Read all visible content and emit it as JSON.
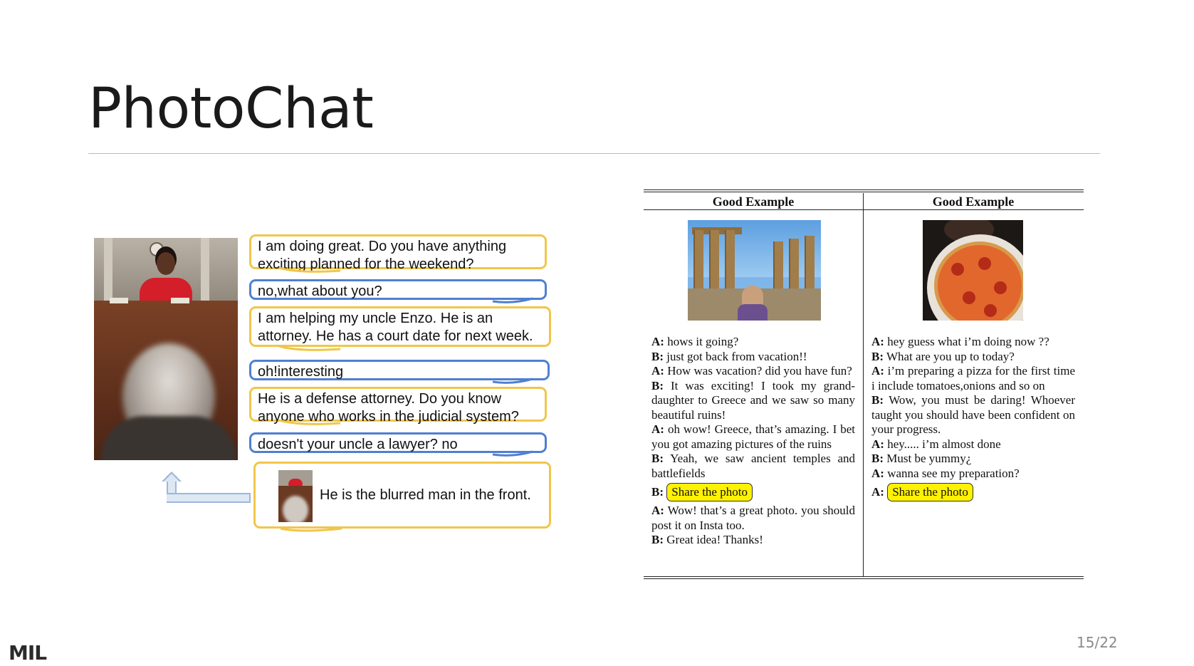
{
  "slide": {
    "title": "PhotoChat",
    "page_number": "15/22",
    "logo_text": "MIL"
  },
  "left_chat": {
    "bubbles": [
      {
        "text_line1": "I am doing great. Do you have anything",
        "text_line2": "exciting planned for the weekend?",
        "color": "#f0c64a"
      },
      {
        "text_line1": "no,what about you?",
        "color": "#4f7fd1"
      },
      {
        "text_line1": "I am helping my uncle Enzo. He is an",
        "text_line2": "attorney. He has a court date for next week.",
        "color": "#f0c64a"
      },
      {
        "text_line1": "oh!interesting",
        "color": "#4f7fd1"
      },
      {
        "text_line1": "He is a defense attorney. Do you know",
        "text_line2": "anyone who works in the judicial system?",
        "color": "#f0c64a"
      },
      {
        "text_line1": "doesn't your uncle a lawyer? no",
        "color": "#4f7fd1"
      },
      {
        "text_line1": "He is the blurred man in the front.",
        "color": "#f0c64a"
      }
    ],
    "icons": [
      "courtroom-photo",
      "share-arrow-icon",
      "courtroom-thumbnail"
    ]
  },
  "table": {
    "headers": [
      "Good Example",
      "Good Example"
    ],
    "col1": [
      {
        "speaker": "A:",
        "text": "hows it going?"
      },
      {
        "speaker": "B:",
        "text": "just got back from vacation!!"
      },
      {
        "speaker": "A:",
        "text": "How was vacation? did you have fun?"
      },
      {
        "speaker": "B:",
        "text": "It was exciting! I took my grand-daughter to Greece and we saw so many beautiful ruins!"
      },
      {
        "speaker": "A:",
        "text": "oh wow! Greece, that’s amazing. I bet you got amazing pictures of the ruins"
      },
      {
        "speaker": "B:",
        "text": "Yeah, we saw ancient temples and battlefields"
      },
      {
        "speaker": "B:",
        "text": "Share the photo",
        "highlight": true
      },
      {
        "speaker": "A:",
        "text": "Wow! that’s a great photo. you should post it on Insta too."
      },
      {
        "speaker": "B:",
        "text": "Great idea! Thanks!"
      }
    ],
    "col2": [
      {
        "speaker": "A:",
        "text": "hey guess what i’m doing now ??"
      },
      {
        "speaker": "B:",
        "text": "What are you up to today?"
      },
      {
        "speaker": "A:",
        "text": "i’m preparing a pizza for the first time i include tomatoes,onions and so on"
      },
      {
        "speaker": "B:",
        "text": "Wow, you must be daring! Whoever taught you should have been confident on your progress."
      },
      {
        "speaker": "A:",
        "text": "hey..... i’m almost done"
      },
      {
        "speaker": "B:",
        "text": "Must be yummy¿"
      },
      {
        "speaker": "A:",
        "text": "wanna see my preparation?"
      },
      {
        "speaker": "A:",
        "text": "Share the photo",
        "highlight": true
      }
    ],
    "highlight_color": "#fff200",
    "images": [
      "greek-ruins-photo",
      "pizza-photo"
    ]
  }
}
